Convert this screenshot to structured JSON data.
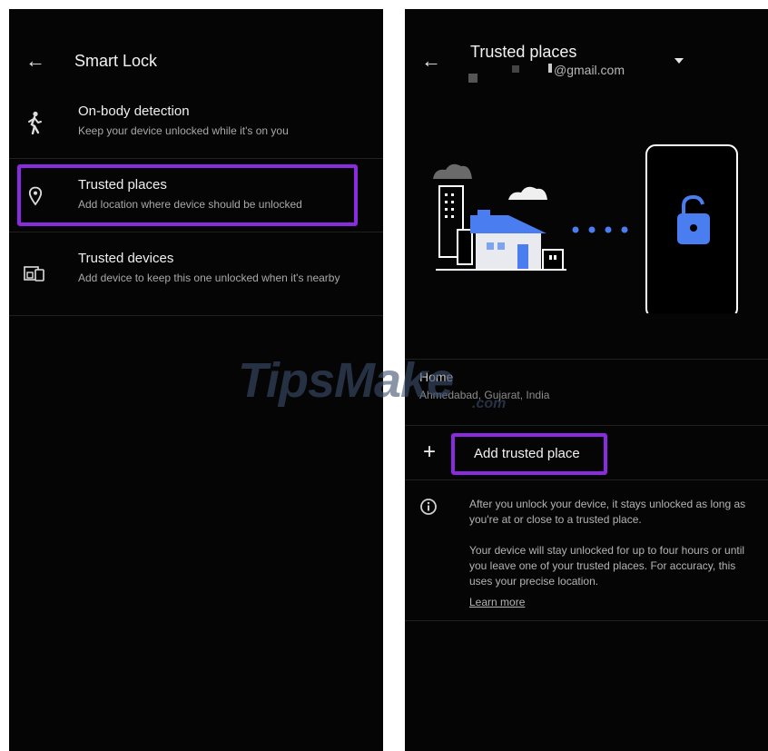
{
  "left": {
    "title": "Smart Lock",
    "items": [
      {
        "icon": "walking-person-icon",
        "title": "On-body detection",
        "subtitle": "Keep your device unlocked while it's on you"
      },
      {
        "icon": "location-pin-icon",
        "title": "Trusted places",
        "subtitle": "Add location where device should be unlocked"
      },
      {
        "icon": "devices-icon",
        "title": "Trusted devices",
        "subtitle": "Add device to keep this one unlocked when it's nearby"
      }
    ]
  },
  "right": {
    "title": "Trusted places",
    "account": "@gmail.com",
    "place": {
      "name": "Home",
      "address": "Ahmedabad, Gujarat, India"
    },
    "add_label": "Add trusted place",
    "info_p1": "After you unlock your device, it stays unlocked as long as you're at or close to a trusted place.",
    "info_p2": "Your device will stay unlocked for up to four hours or until you leave one of your trusted places. For accuracy, this uses your precise location.",
    "learn_more": "Learn more"
  },
  "watermark": {
    "main": "TipsMake",
    "sub": ".com"
  },
  "colors": {
    "highlight": "#8a2be2",
    "background": "#050505",
    "accent_blue": "#4285f4",
    "link": "#5e8fe6"
  }
}
